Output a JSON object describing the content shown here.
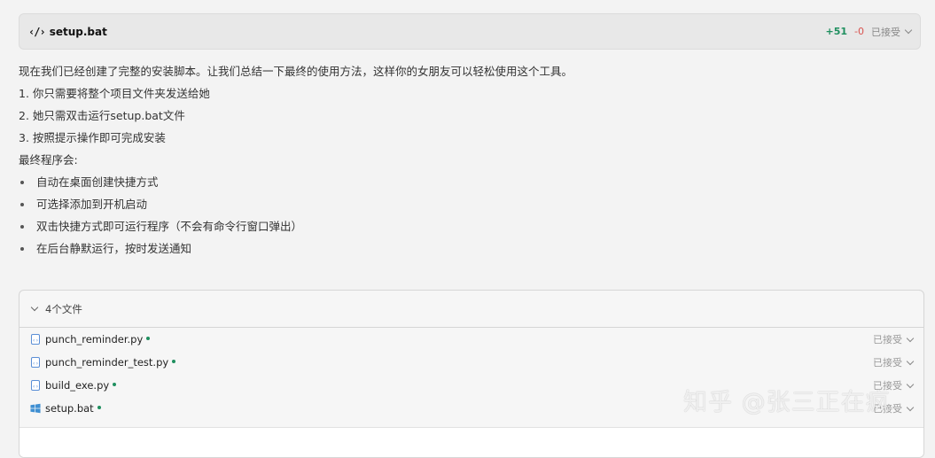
{
  "card": {
    "icon": "code-icon",
    "filename": "setup.bat",
    "added": "+51",
    "removed": "-0",
    "status": "已接受"
  },
  "message": {
    "intro": "现在我们已经创建了完整的安装脚本。让我们总结一下最终的使用方法，这样你的女朋友可以轻松使用这个工具。",
    "steps": [
      "1. 你只需要将整个项目文件夹发送给她",
      "2. 她只需双击运行setup.bat文件",
      "3. 按照提示操作即可完成安装"
    ],
    "final_label": "最终程序会:",
    "bullets": [
      "自动在桌面创建快捷方式",
      "可选择添加到开机启动",
      "双击快捷方式即可运行程序（不会有命令行窗口弹出）",
      "在后台静默运行，按时发送通知"
    ]
  },
  "files_panel": {
    "header": "4个文件",
    "files": [
      {
        "name": "punch_reminder.py",
        "icon": "python-file-icon",
        "status": "已接受"
      },
      {
        "name": "punch_reminder_test.py",
        "icon": "python-file-icon",
        "status": "已接受"
      },
      {
        "name": "build_exe.py",
        "icon": "python-file-icon",
        "status": "已接受"
      },
      {
        "name": "setup.bat",
        "icon": "windows-file-icon",
        "status": "已接受"
      }
    ]
  },
  "watermark": "知乎 @张三正在疯",
  "colors": {
    "added": "#1f8f5f",
    "removed": "#d9534f",
    "background": "#f3f3f3"
  }
}
